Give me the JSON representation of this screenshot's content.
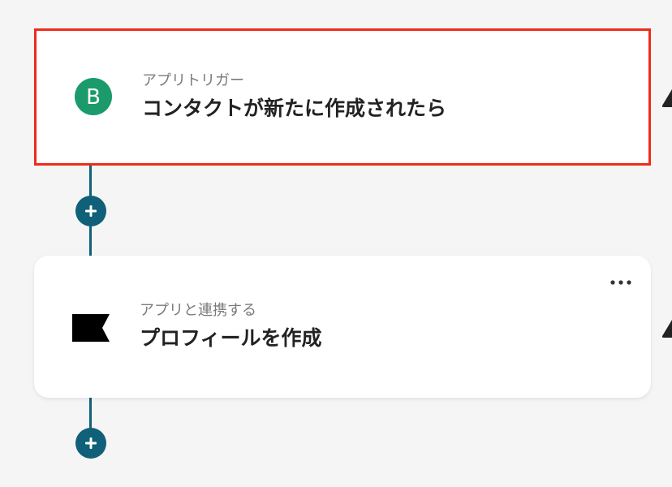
{
  "colors": {
    "accent": "#0f6078",
    "highlight_border": "#ee2b1a",
    "trigger_app": "#1b9a6c"
  },
  "flow": {
    "trigger_step": {
      "app_icon": "brevo-b-icon",
      "app_icon_letter": "B",
      "subtitle": "アプリトリガー",
      "title": "コンタクトが新たに作成されたら"
    },
    "action_step": {
      "app_icon": "black-flag-icon",
      "subtitle": "アプリと連携する",
      "title": "プロフィールを作成",
      "menu_icon": "more-horizontal-icon"
    },
    "add_buttons": [
      {
        "icon": "plus-icon"
      },
      {
        "icon": "plus-icon"
      }
    ]
  }
}
